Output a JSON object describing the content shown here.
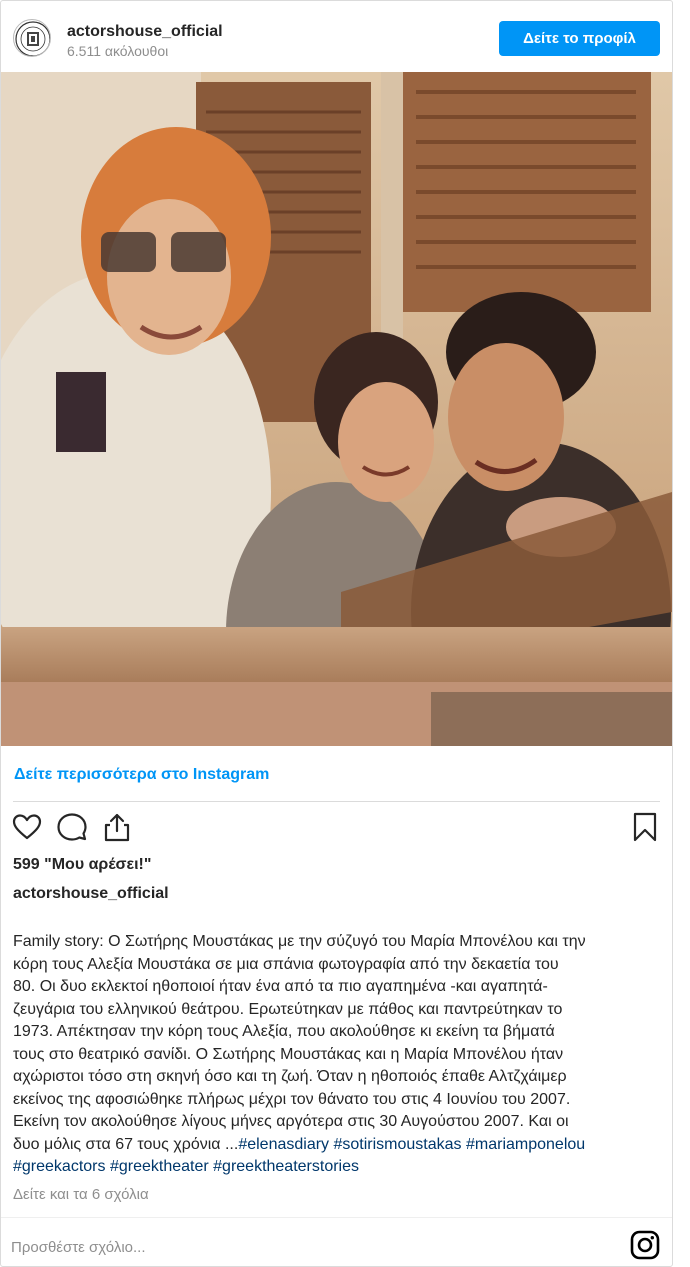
{
  "header": {
    "username": "actorshouse_official",
    "followers": "6.511 ακόλουθοι",
    "profile_button": "Δείτε το προφίλ"
  },
  "post": {
    "view_more_link": "Δείτε περισσότερα στο Instagram",
    "likes": "599 \"Μου αρέσει!\"",
    "owner": "actorshouse_official",
    "caption_lines": [
      "Family story: Ο Σωτήρης Μουστάκας με την σύζυγό του Μαρία Μπονέλου και την",
      "κόρη τους Αλεξία Μουστάκα σε μια σπάνια φωτογραφία από την δεκαετία του",
      "80. Οι δυο εκλεκτοί ηθοποιοί ήταν ένα από τα πιο αγαπημένα -και αγαπητά-",
      "ζευγάρια του ελληνικού θεάτρου. Ερωτεύτηκαν με πάθος και παντρεύτηκαν το",
      "1973. Απέκτησαν την κόρη τους Αλεξία, που ακολούθησε κι εκείνη τα βήματά",
      "τους στο θεατρικό σανίδι. Ο Σωτήρης Μουστάκας και η Μαρία Μπονέλου ήταν",
      "αχώριστοι τόσο στη σκηνή όσο και τη ζωή. Όταν η ηθοποιός έπαθε Αλτζχάιμερ",
      "εκείνος της αφοσιώθηκε πλήρως μέχρι τον θάνατο του στις 4 Ιουνίου του 2007.",
      "Εκείνη τον ακολούθησε λίγους μήνες αργότερα στις 30 Αυγούστου 2007. Και οι"
    ],
    "caption_last_line_text": "δυο μόλις στα 67 τους χρόνια ...",
    "hashtags_line1": [
      "#elenasdiary",
      "#sotirismoustakas",
      "#mariamponelou"
    ],
    "hashtags_line2": [
      "#greekactors",
      "#greektheater",
      "#greektheaterstories"
    ],
    "comments_link": "Δείτε και τα 6 σχόλια",
    "add_comment_placeholder": "Προσθέστε σχόλιο..."
  },
  "icons": {
    "like": "heart-icon",
    "comment": "comment-icon",
    "share": "share-icon",
    "save": "bookmark-icon",
    "instagram": "instagram-logo-icon"
  },
  "colors": {
    "accent": "#0095f6",
    "hashtag": "#00376b",
    "secondary_text": "#8e8e8e"
  }
}
